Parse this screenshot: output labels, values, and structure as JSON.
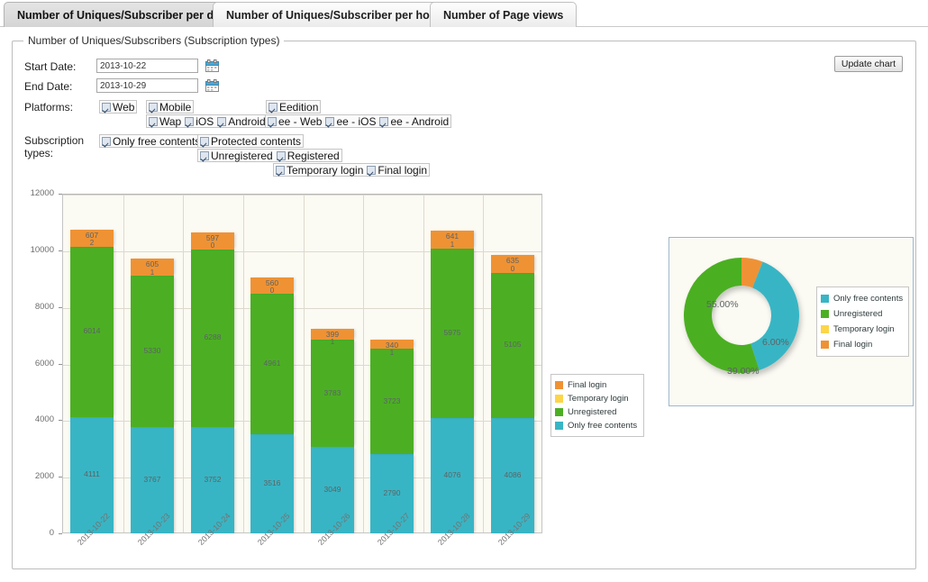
{
  "tabs": [
    {
      "label": "Number of Uniques/Subscriber per day",
      "active": true
    },
    {
      "label": "Number of Uniques/Subscriber per hour",
      "active": false
    },
    {
      "label": "Number of Page views",
      "active": false
    }
  ],
  "panel": {
    "legend": "Number of Uniques/Subscribers (Subscription types)",
    "update_button": "Update chart"
  },
  "form": {
    "start_date_label": "Start Date:",
    "start_date_value": "2013-10-22",
    "end_date_label": "End Date:",
    "end_date_value": "2013-10-29",
    "platforms_label": "Platforms:",
    "subscription_label_line1": "Subscription",
    "subscription_label_line2": "types:",
    "platforms_row1": [
      {
        "label": "Web",
        "checked": true
      },
      {
        "label": "Mobile",
        "checked": true
      }
    ],
    "platforms_row1b": [
      {
        "label": "Eedition",
        "checked": true
      }
    ],
    "platforms_row2": [
      {
        "label": "Wap",
        "checked": true
      },
      {
        "label": "iOS",
        "checked": true
      },
      {
        "label": "Android",
        "checked": true
      }
    ],
    "platforms_row2b": [
      {
        "label": "ee - Web",
        "checked": true
      },
      {
        "label": "ee - iOS",
        "checked": true
      },
      {
        "label": "ee - Android",
        "checked": true
      }
    ],
    "subs_row1a": [
      {
        "label": "Only free contents",
        "checked": true
      }
    ],
    "subs_row1b": [
      {
        "label": "Protected contents",
        "checked": true
      }
    ],
    "subs_row2": [
      {
        "label": "Unregistered",
        "checked": true
      },
      {
        "label": "Registered",
        "checked": true
      }
    ],
    "subs_row3": [
      {
        "label": "Temporary login",
        "checked": true
      },
      {
        "label": "Final login",
        "checked": true
      }
    ]
  },
  "colors": {
    "final_login": "#ef9234",
    "temporary_login": "#fcd548",
    "unregistered": "#4caf23",
    "only_free_contents": "#38b5c4",
    "plot_bg": "#fbfaf3",
    "grid": "#ddd9cd"
  },
  "chart_data": [
    {
      "type": "bar",
      "title": "",
      "stacked": true,
      "xlabel": "",
      "ylabel": "",
      "ylim": [
        0,
        12000
      ],
      "yticks": [
        0,
        2000,
        4000,
        6000,
        8000,
        10000,
        12000
      ],
      "grid": true,
      "legend_position": "right",
      "categories": [
        "2013-10-22",
        "2013-10-23",
        "2013-10-24",
        "2013-10-25",
        "2013-10-26",
        "2013-10-27",
        "2013-10-28",
        "2013-10-29"
      ],
      "series": [
        {
          "name": "Only free contents",
          "color": "#38b5c4",
          "values": [
            4111,
            3767,
            3752,
            3516,
            3049,
            2790,
            4076,
            4086
          ]
        },
        {
          "name": "Unregistered",
          "color": "#4caf23",
          "values": [
            6014,
            5330,
            6288,
            4961,
            3783,
            3723,
            5975,
            5105
          ]
        },
        {
          "name": "Temporary login",
          "color": "#fcd548",
          "values": [
            2,
            1,
            0,
            0,
            1,
            1,
            1,
            0
          ]
        },
        {
          "name": "Final login",
          "color": "#ef9234",
          "values": [
            607,
            605,
            597,
            560,
            399,
            340,
            641,
            635
          ]
        }
      ],
      "legend": [
        "Final login",
        "Temporary login",
        "Unregistered",
        "Only free contents"
      ]
    },
    {
      "type": "pie",
      "variant": "donut",
      "title": "",
      "legend_position": "right",
      "labels": [
        "Only free contents",
        "Unregistered",
        "Temporary login",
        "Final login"
      ],
      "colors": [
        "#38b5c4",
        "#4caf23",
        "#fcd548",
        "#ef9234"
      ],
      "values": [
        39.0,
        55.0,
        0.0,
        6.0
      ],
      "display_labels": [
        "39.00%",
        "55.00%",
        "",
        "6.00%"
      ],
      "visible_slice_labels": [
        {
          "text": "55.00%",
          "series": "Unregistered"
        },
        {
          "text": "39.00%",
          "series": "Only free contents"
        },
        {
          "text": "6.00%",
          "series": "Final login"
        }
      ]
    }
  ]
}
